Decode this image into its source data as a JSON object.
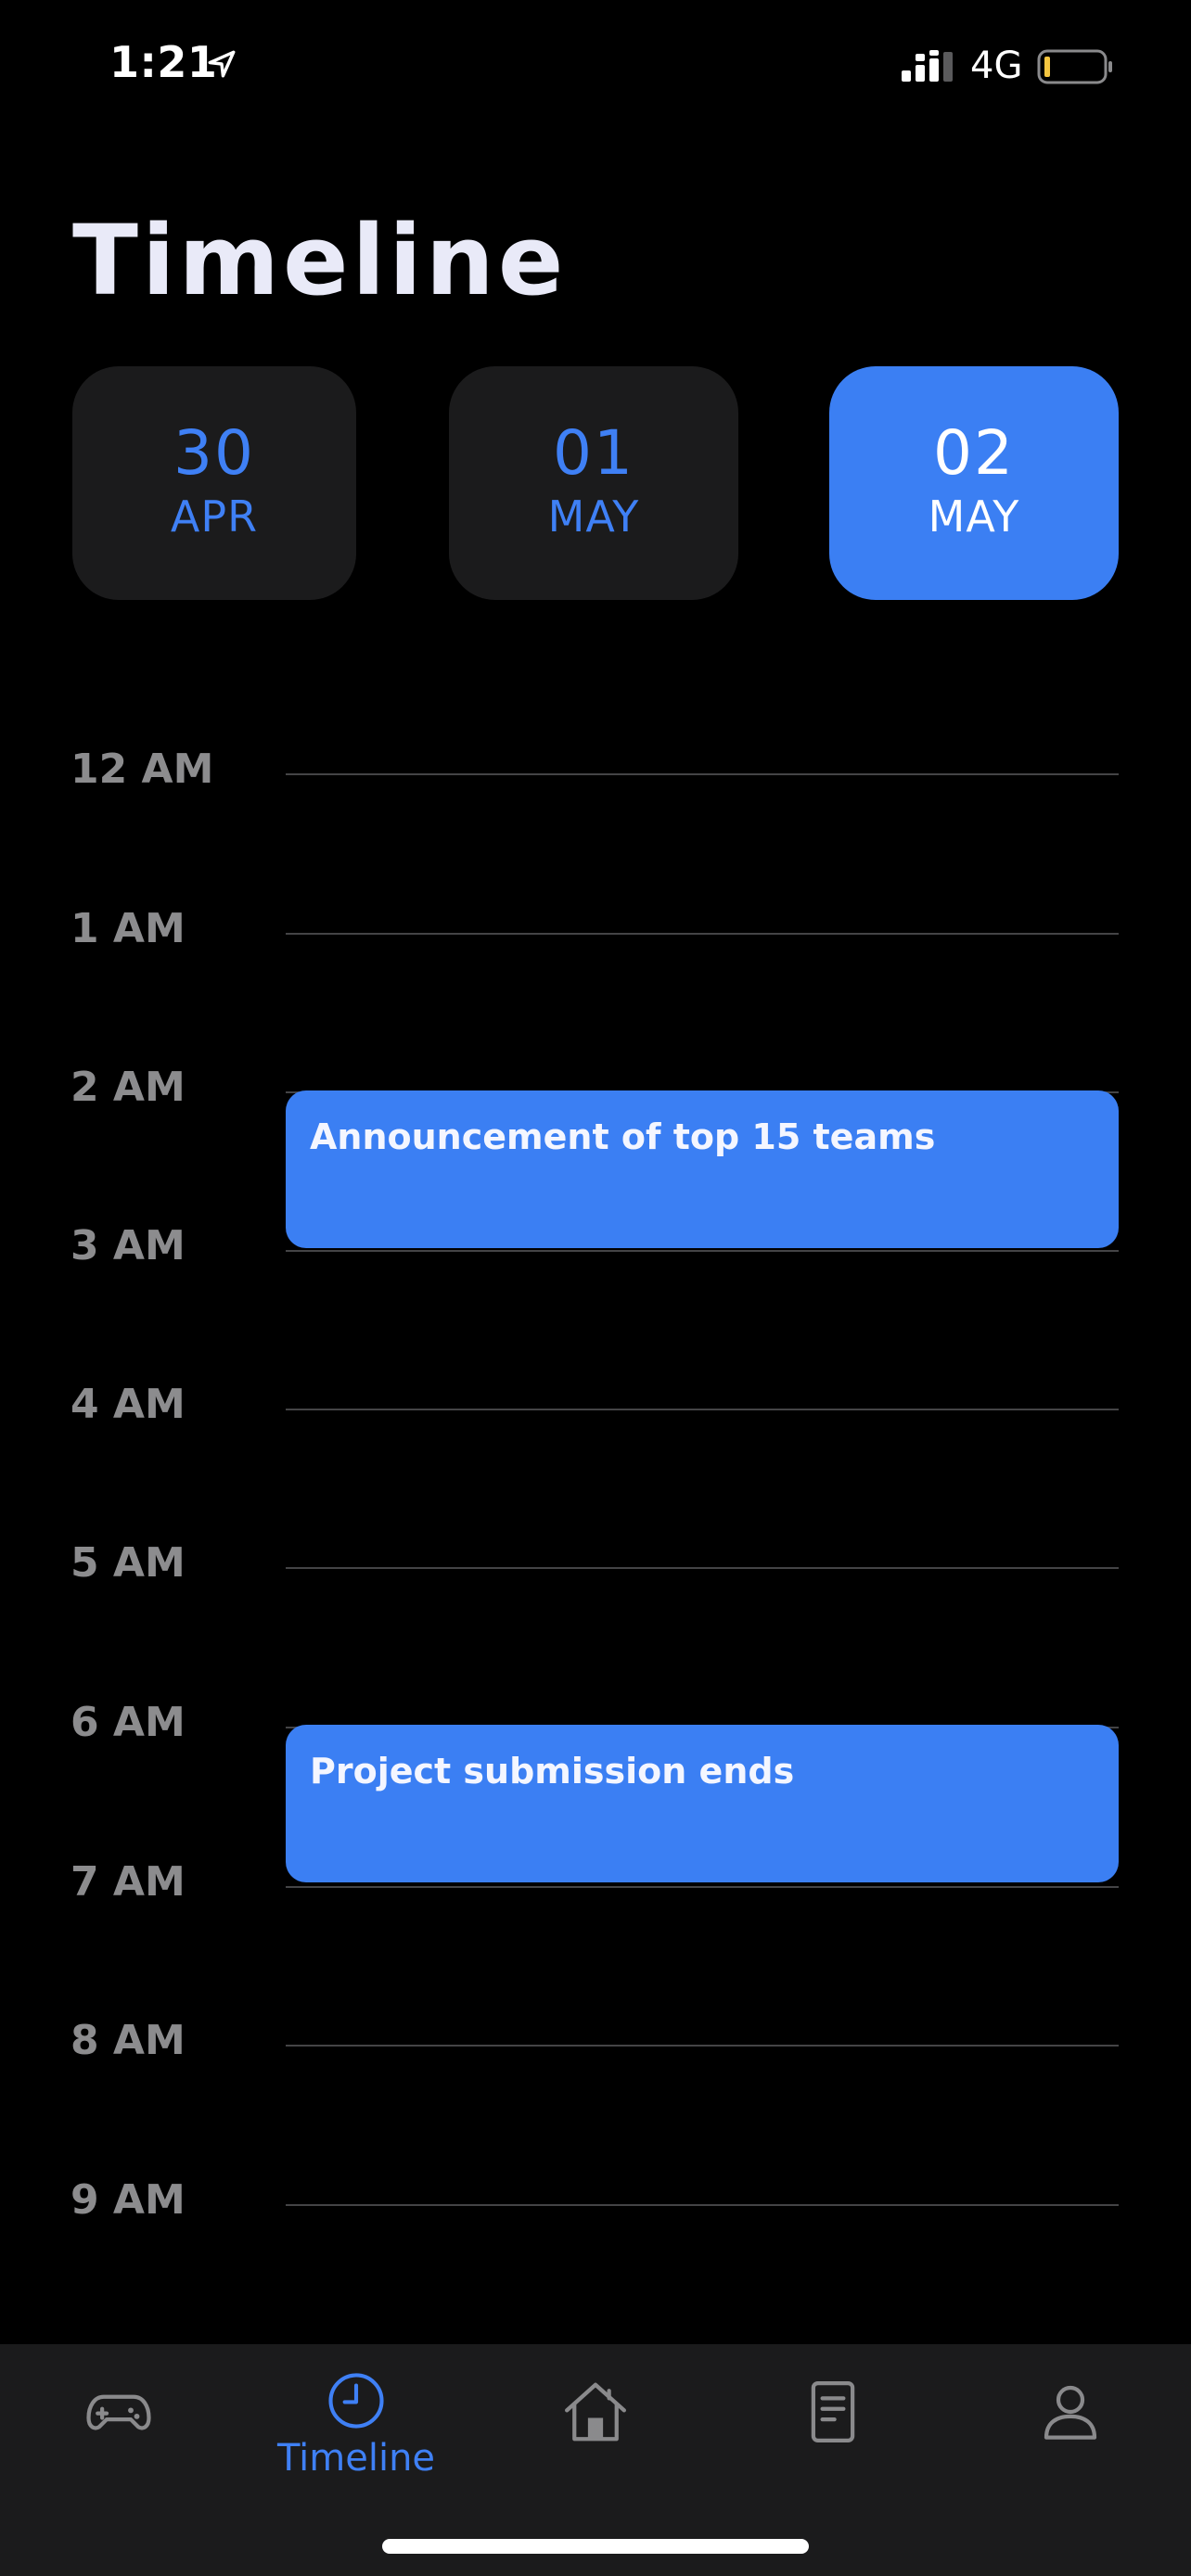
{
  "status_bar": {
    "time": "1:21",
    "network": "4G",
    "icons": [
      "location-arrow-icon",
      "signal-icon",
      "battery-icon"
    ]
  },
  "page": {
    "title": "Timeline"
  },
  "dates": [
    {
      "day": "30",
      "month": "APR",
      "selected": false
    },
    {
      "day": "01",
      "month": "MAY",
      "selected": false
    },
    {
      "day": "02",
      "month": "MAY",
      "selected": true
    }
  ],
  "timeline": {
    "hours": [
      "12 AM",
      "1 AM",
      "2 AM",
      "3 AM",
      "4 AM",
      "5 AM",
      "6 AM",
      "7 AM",
      "8 AM",
      "9 AM"
    ],
    "events": [
      {
        "title": "Announcement of top 15 teams",
        "start": "2 AM",
        "end": "3 AM"
      },
      {
        "title": "Project submission ends",
        "start": "6 AM",
        "end": "7 AM"
      }
    ]
  },
  "tab_bar": {
    "items": [
      {
        "icon": "gamepad-icon",
        "label": "",
        "active": false
      },
      {
        "icon": "clock-icon",
        "label": "Timeline",
        "active": true
      },
      {
        "icon": "house-icon",
        "label": "",
        "active": false
      },
      {
        "icon": "document-icon",
        "label": "",
        "active": false
      },
      {
        "icon": "user-icon",
        "label": "",
        "active": false
      }
    ]
  },
  "colors": {
    "background": "#000000",
    "accent": "#3b7ff3",
    "chip_background": "#1b1b1c",
    "hour_label": "#8c8c8e",
    "inactive_icon": "#8a8a8c"
  }
}
